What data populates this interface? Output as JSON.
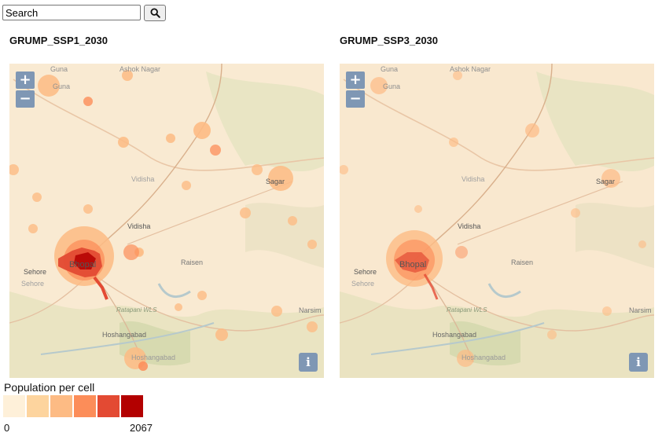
{
  "search": {
    "placeholder": "Search",
    "button_icon": "search-icon"
  },
  "maps": [
    {
      "title": "GRUMP_SSP1_2030",
      "places": [
        "Guna",
        "Ashok Nagar",
        "Vidisha",
        "Vidisha",
        "Sagar",
        "Bhopal",
        "Raisen",
        "Sehore",
        "Sehore",
        "Ratapani WLS",
        "Narsim",
        "Hoshangabad",
        "Hoshangabad"
      ],
      "zoom_in": "+",
      "zoom_out": "−",
      "info": "i"
    },
    {
      "title": "GRUMP_SSP3_2030",
      "places": [
        "Guna",
        "Ashok Nagar",
        "Vidisha",
        "Vidisha",
        "Sagar",
        "Bhopal",
        "Raisen",
        "Sehore",
        "Sehore",
        "Ratapani WLS",
        "Narsim",
        "Hoshangabad",
        "Hoshangabad"
      ],
      "zoom_in": "+",
      "zoom_out": "−",
      "info": "i"
    }
  ],
  "legend": {
    "title": "Population per cell",
    "min": "0",
    "max": "2067",
    "colors": [
      "#fef0d9",
      "#fdd49e",
      "#fdbb84",
      "#fc8d59",
      "#e34a33",
      "#b30000"
    ]
  },
  "colors": {
    "control_bg": "#7f97b4",
    "base_map": "#f9ead2"
  }
}
